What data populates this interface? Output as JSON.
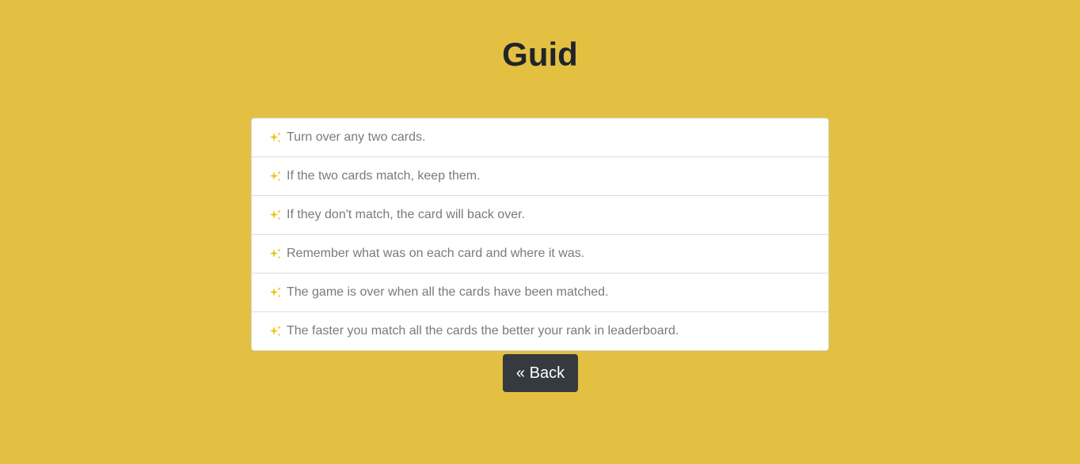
{
  "header": {
    "title": "Guid"
  },
  "rules": {
    "items": [
      {
        "icon": "sparkle-icon",
        "text": "Turn over any two cards."
      },
      {
        "icon": "sparkle-icon",
        "text": "If the two cards match, keep them."
      },
      {
        "icon": "sparkle-icon",
        "text": "If they don't match, the card will back over."
      },
      {
        "icon": "sparkle-icon",
        "text": "Remember what was on each card and where it was."
      },
      {
        "icon": "sparkle-icon",
        "text": "The game is over when all the cards have been matched."
      },
      {
        "icon": "sparkle-icon",
        "text": "The faster you match all the cards the better your rank in leaderboard."
      }
    ]
  },
  "actions": {
    "back_label": "« Back"
  },
  "colors": {
    "background": "#e3c042",
    "icon": "#e7c61a",
    "button": "#343a40",
    "text_muted": "#7a7a7a",
    "title": "#212529"
  }
}
